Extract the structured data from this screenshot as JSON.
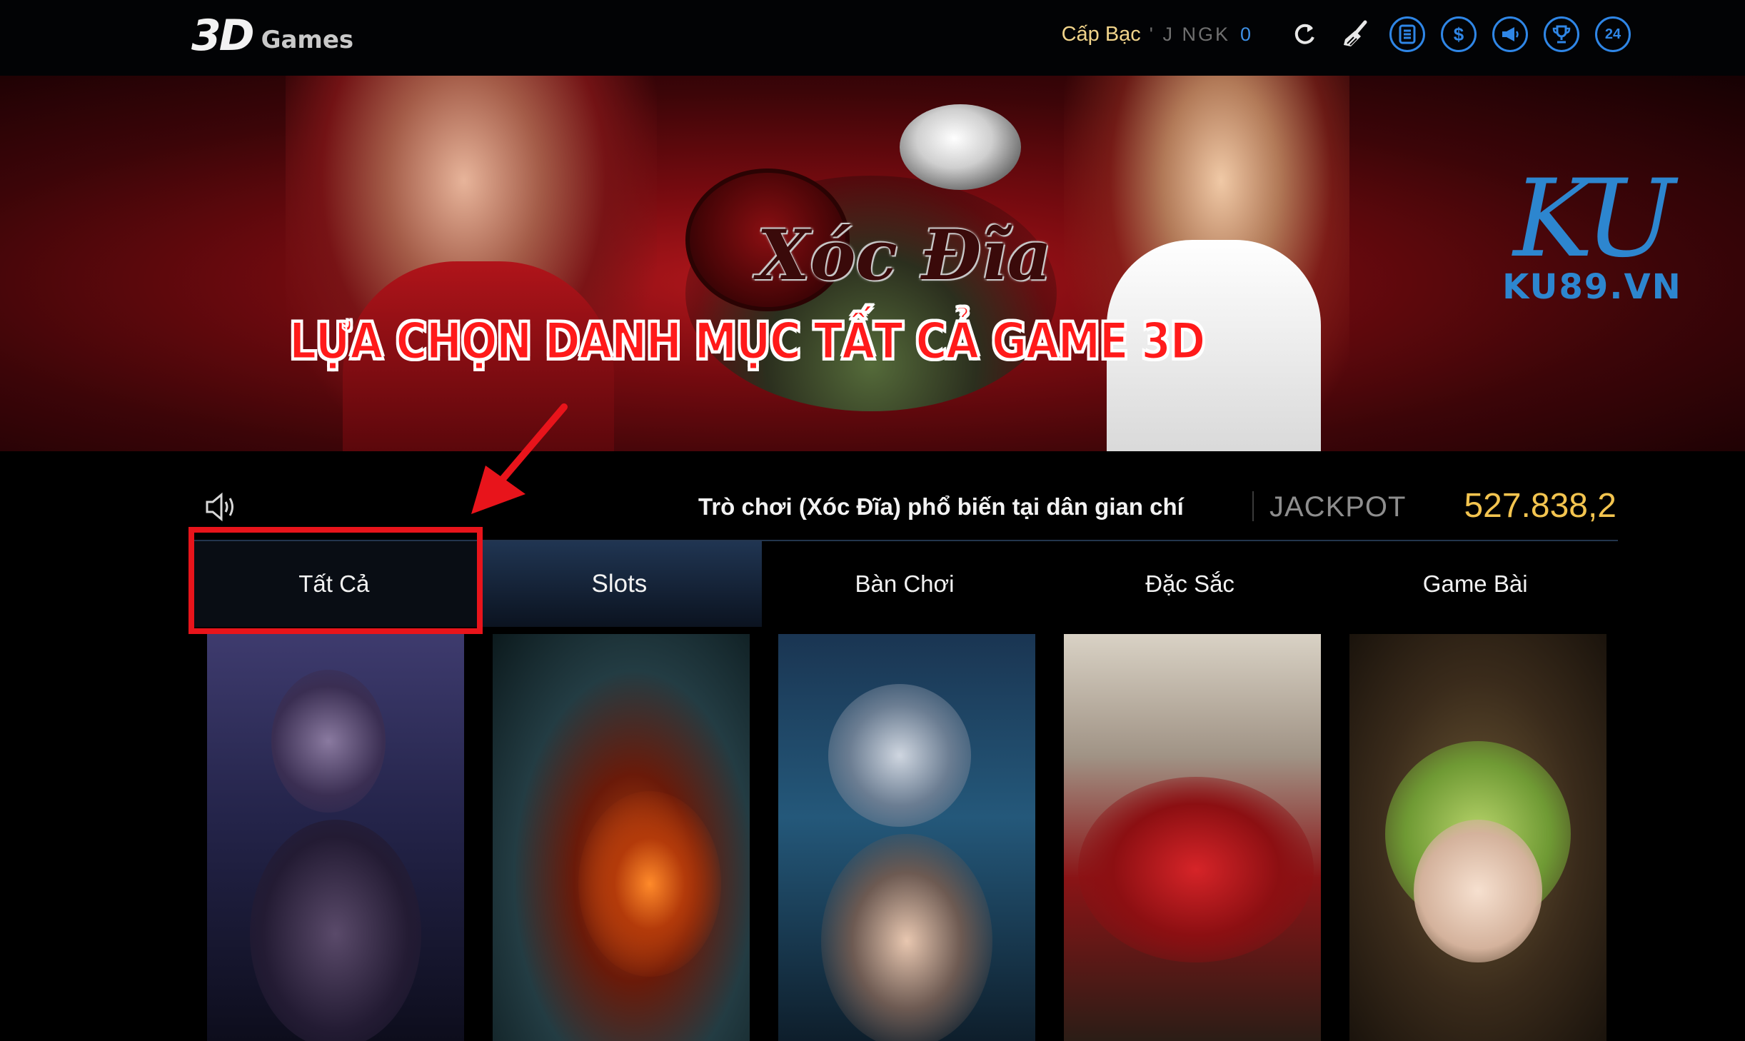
{
  "header": {
    "logo_3d": "3D",
    "logo_games": "Games",
    "level": "Cấp Bạc",
    "username": "' J NGK",
    "balance": "0",
    "icons": [
      "refresh-icon",
      "broom-icon",
      "list-icon",
      "dollar-icon",
      "megaphone-icon",
      "trophy-icon",
      "support-24-icon"
    ],
    "support_badge": "24",
    "dollar_symbol": "$"
  },
  "banner": {
    "title": "Xóc Đĩa",
    "annotation": "LỰA CHỌN DANH MỤC TẤT CẢ GAME 3D",
    "brand_mark": "KU",
    "brand_site": "KU89.VN",
    "slide_count": 5,
    "active_slide": 2
  },
  "ticker": {
    "message": "Trò chơi (Xóc Đĩa) phổ biến tại dân gian chí",
    "jackpot_label": "JACKPOT",
    "jackpot_value": "527.838,2"
  },
  "tabs": [
    {
      "label": "Tất Cả",
      "selected": true
    },
    {
      "label": "Slots",
      "selected": false
    },
    {
      "label": "Bàn Chơi",
      "selected": false
    },
    {
      "label": "Đặc Sắc",
      "selected": false
    },
    {
      "label": "Game Bài",
      "selected": false
    }
  ],
  "colors": {
    "accent_blue": "#2f86e6",
    "jackpot_gold": "#f3c44f",
    "highlight_red": "#e8141b"
  }
}
